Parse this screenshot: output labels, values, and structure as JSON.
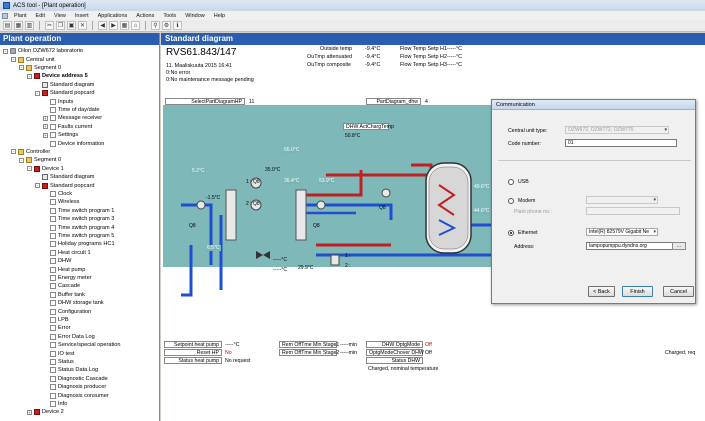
{
  "window": {
    "title": "ACS tool - [Plant operation]"
  },
  "menu": [
    "Plant",
    "Edit",
    "View",
    "Insert",
    "Applications",
    "Actions",
    "Tools",
    "Window",
    "Help"
  ],
  "tree": {
    "header": "Plant operation",
    "items": [
      {
        "label": "Oilon OZW672 laboratorio",
        "level": 0,
        "exp": "-",
        "icon": "plant"
      },
      {
        "label": "Central unit",
        "level": 1,
        "exp": "-",
        "icon": "folder"
      },
      {
        "label": "Segment 0",
        "level": 2,
        "exp": "-",
        "icon": "folder"
      },
      {
        "label": "Device address 5",
        "level": 3,
        "exp": "-",
        "icon": "device",
        "bold": true
      },
      {
        "label": "Standard diagram",
        "level": 4,
        "exp": "",
        "icon": "diagram"
      },
      {
        "label": "Standard popcard",
        "level": 4,
        "exp": "-",
        "icon": "popcard"
      },
      {
        "label": "Inputs",
        "level": 5,
        "exp": "",
        "icon": "page"
      },
      {
        "label": "Time of day/date",
        "level": 5,
        "exp": "",
        "icon": "page"
      },
      {
        "label": "Message receiver",
        "level": 5,
        "exp": "+",
        "icon": "page"
      },
      {
        "label": "Faults current",
        "level": 5,
        "exp": "+",
        "icon": "page"
      },
      {
        "label": "Settings",
        "level": 5,
        "exp": "+",
        "icon": "page"
      },
      {
        "label": "Device information",
        "level": 5,
        "exp": "",
        "icon": "page"
      },
      {
        "label": "Controller",
        "level": 1,
        "exp": "-",
        "icon": "folder"
      },
      {
        "label": "Segment 0",
        "level": 2,
        "exp": "-",
        "icon": "folder"
      },
      {
        "label": "Device 1",
        "level": 3,
        "exp": "-",
        "icon": "device"
      },
      {
        "label": "Standard diagram",
        "level": 4,
        "exp": "",
        "icon": "diagram"
      },
      {
        "label": "Standard popcard",
        "level": 4,
        "exp": "-",
        "icon": "popcard"
      },
      {
        "label": "Clock",
        "level": 5,
        "exp": "",
        "icon": "page"
      },
      {
        "label": "Wireless",
        "level": 5,
        "exp": "",
        "icon": "page"
      },
      {
        "label": "Time switch program 1",
        "level": 5,
        "exp": "",
        "icon": "page"
      },
      {
        "label": "Time switch program 3",
        "level": 5,
        "exp": "",
        "icon": "page"
      },
      {
        "label": "Time switch program 4",
        "level": 5,
        "exp": "",
        "icon": "page"
      },
      {
        "label": "Time switch program 5",
        "level": 5,
        "exp": "",
        "icon": "page"
      },
      {
        "label": "Holiday programs HC1",
        "level": 5,
        "exp": "",
        "icon": "page"
      },
      {
        "label": "Heat circuit 1",
        "level": 5,
        "exp": "",
        "icon": "page"
      },
      {
        "label": "DHW",
        "level": 5,
        "exp": "",
        "icon": "page"
      },
      {
        "label": "Heat pump",
        "level": 5,
        "exp": "",
        "icon": "page"
      },
      {
        "label": "Energy meter",
        "level": 5,
        "exp": "",
        "icon": "page"
      },
      {
        "label": "Cascade",
        "level": 5,
        "exp": "",
        "icon": "page"
      },
      {
        "label": "Buffer tank",
        "level": 5,
        "exp": "",
        "icon": "page"
      },
      {
        "label": "DHW storage tank",
        "level": 5,
        "exp": "",
        "icon": "page"
      },
      {
        "label": "Configuration",
        "level": 5,
        "exp": "",
        "icon": "page"
      },
      {
        "label": "LPB",
        "level": 5,
        "exp": "",
        "icon": "page"
      },
      {
        "label": "Error",
        "level": 5,
        "exp": "",
        "icon": "page"
      },
      {
        "label": "Error Data Log",
        "level": 5,
        "exp": "",
        "icon": "page"
      },
      {
        "label": "Service/special operation",
        "level": 5,
        "exp": "",
        "icon": "page"
      },
      {
        "label": "IO test",
        "level": 5,
        "exp": "",
        "icon": "page"
      },
      {
        "label": "Status",
        "level": 5,
        "exp": "",
        "icon": "page"
      },
      {
        "label": "Status Data Log",
        "level": 5,
        "exp": "",
        "icon": "page"
      },
      {
        "label": "Diagnostic Cascade",
        "level": 5,
        "exp": "",
        "icon": "page"
      },
      {
        "label": "Diagnosis producer",
        "level": 5,
        "exp": "",
        "icon": "page"
      },
      {
        "label": "Diagnosis consumer",
        "level": 5,
        "exp": "",
        "icon": "page"
      },
      {
        "label": "Info",
        "level": 5,
        "exp": "",
        "icon": "page"
      },
      {
        "label": "Device 2",
        "level": 3,
        "exp": "+",
        "icon": "device"
      }
    ]
  },
  "main": {
    "header": "Standard diagram",
    "device_type": "RVS61.843/147",
    "datetime": "11. Maaliskuuta 2015 16:41",
    "status1": "0:No error",
    "status2": "0:No maintenance message pending",
    "outside_temp_label": "Outside temp",
    "outside_temp_value": "-9.4°C",
    "outside_temp_att_label": "OuTmp attenuated",
    "outside_temp_att_value": "-9.4°C",
    "outside_temp_comp_label": "OuTmp composite",
    "outside_temp_comp_value": "-9.4°C",
    "flow_h1_label": "Flow Temp Setp H1",
    "flow_h1_value": "-----°C",
    "flow_h2_label": "Flow Temp Setp H2",
    "flow_h2_value": "-----°C",
    "flow_h3_label": "Flow Temp Setp H3",
    "flow_h3_value": "-----°C"
  },
  "diagram": {
    "select_label": "SelectPartDiagramHP",
    "select_value": "11",
    "part_label": "PartDiagram_dhw",
    "part_value": "4",
    "dhw_actcharg": "DHW ActChargTemp",
    "dhw_actcharg_value": "50.8°C",
    "v1": "5.2°C",
    "v2": "-1.5°C",
    "v3": "66.0°C",
    "v4": "35.0°C",
    "v5": "36.4°C",
    "v6": "53.9°C",
    "v7": "49.6°C",
    "v8": "44.6°C",
    "v9": "6.5°C",
    "v10": "29.9°C",
    "v11": "-----°C",
    "v12": "-----°C",
    "q1": "1 : Q8",
    "q2": "2 : Q8",
    "q3": "Q8",
    "q4": "Q8",
    "q5": "Q8",
    "r1": "1 :",
    "r2": "2 :"
  },
  "bottom": {
    "setpoint_label": "Setpoint heat pump",
    "setpoint_value": "-----°C",
    "reset_label": "Reset HP",
    "reset_value": "No",
    "status_hp_label": "Status heat pump",
    "status_hp_value": "No request",
    "rem1_label": "Rem OffTme Min Stage1",
    "rem1_value": "-----min",
    "rem2_label": "Rem OffTme Min Stage2",
    "rem2_value": "-----min",
    "dhw_opt_label": "DHW OptgMode",
    "dhw_opt_value": "Off",
    "dhw_opt2_label": "OptgModeChover DHW",
    "dhw_opt2_value": "Off",
    "status_dhw_label": "Status DHW",
    "status_dhw_value": "Charged, nominal temperature",
    "right_status_value": "Charged, req"
  },
  "dialog": {
    "title": "Communication",
    "central_label": "Central unit type:",
    "central_value": "OZW672, OZW772, OZW775",
    "code_label": "Code number:",
    "code_value": "01",
    "usb_label": "USB",
    "modem_label": "Modem",
    "phone_label": "Plant phone no.:",
    "ethernet_label": "Ethernet",
    "ethernet_value": "Intel(R) 82579V Gigabit Ne",
    "address_label": "Address:",
    "address_value": "lampopumppu.dyndns.org",
    "back_label": "< Back",
    "finish_label": "Finish",
    "cancel_label": "Cancel"
  }
}
